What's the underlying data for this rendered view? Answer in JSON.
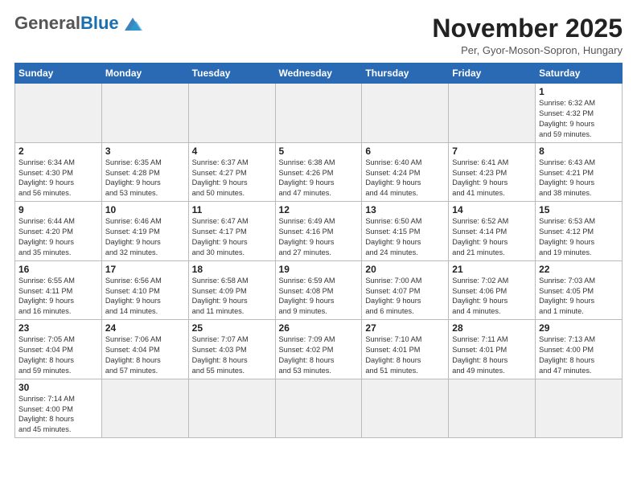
{
  "logo": {
    "general": "General",
    "blue": "Blue"
  },
  "header": {
    "month": "November 2025",
    "location": "Per, Gyor-Moson-Sopron, Hungary"
  },
  "weekdays": [
    "Sunday",
    "Monday",
    "Tuesday",
    "Wednesday",
    "Thursday",
    "Friday",
    "Saturday"
  ],
  "days": {
    "1": {
      "sunrise": "6:32 AM",
      "sunset": "4:32 PM",
      "daylight_h": "9",
      "daylight_m": "59"
    },
    "2": {
      "sunrise": "6:34 AM",
      "sunset": "4:30 PM",
      "daylight_h": "9",
      "daylight_m": "56"
    },
    "3": {
      "sunrise": "6:35 AM",
      "sunset": "4:28 PM",
      "daylight_h": "9",
      "daylight_m": "53"
    },
    "4": {
      "sunrise": "6:37 AM",
      "sunset": "4:27 PM",
      "daylight_h": "9",
      "daylight_m": "50"
    },
    "5": {
      "sunrise": "6:38 AM",
      "sunset": "4:26 PM",
      "daylight_h": "9",
      "daylight_m": "47"
    },
    "6": {
      "sunrise": "6:40 AM",
      "sunset": "4:24 PM",
      "daylight_h": "9",
      "daylight_m": "44"
    },
    "7": {
      "sunrise": "6:41 AM",
      "sunset": "4:23 PM",
      "daylight_h": "9",
      "daylight_m": "41"
    },
    "8": {
      "sunrise": "6:43 AM",
      "sunset": "4:21 PM",
      "daylight_h": "9",
      "daylight_m": "38"
    },
    "9": {
      "sunrise": "6:44 AM",
      "sunset": "4:20 PM",
      "daylight_h": "9",
      "daylight_m": "35"
    },
    "10": {
      "sunrise": "6:46 AM",
      "sunset": "4:19 PM",
      "daylight_h": "9",
      "daylight_m": "32"
    },
    "11": {
      "sunrise": "6:47 AM",
      "sunset": "4:17 PM",
      "daylight_h": "9",
      "daylight_m": "30"
    },
    "12": {
      "sunrise": "6:49 AM",
      "sunset": "4:16 PM",
      "daylight_h": "9",
      "daylight_m": "27"
    },
    "13": {
      "sunrise": "6:50 AM",
      "sunset": "4:15 PM",
      "daylight_h": "9",
      "daylight_m": "24"
    },
    "14": {
      "sunrise": "6:52 AM",
      "sunset": "4:14 PM",
      "daylight_h": "9",
      "daylight_m": "21"
    },
    "15": {
      "sunrise": "6:53 AM",
      "sunset": "4:12 PM",
      "daylight_h": "9",
      "daylight_m": "19"
    },
    "16": {
      "sunrise": "6:55 AM",
      "sunset": "4:11 PM",
      "daylight_h": "9",
      "daylight_m": "16"
    },
    "17": {
      "sunrise": "6:56 AM",
      "sunset": "4:10 PM",
      "daylight_h": "9",
      "daylight_m": "14"
    },
    "18": {
      "sunrise": "6:58 AM",
      "sunset": "4:09 PM",
      "daylight_h": "9",
      "daylight_m": "11"
    },
    "19": {
      "sunrise": "6:59 AM",
      "sunset": "4:08 PM",
      "daylight_h": "9",
      "daylight_m": "9"
    },
    "20": {
      "sunrise": "7:00 AM",
      "sunset": "4:07 PM",
      "daylight_h": "9",
      "daylight_m": "6"
    },
    "21": {
      "sunrise": "7:02 AM",
      "sunset": "4:06 PM",
      "daylight_h": "9",
      "daylight_m": "4"
    },
    "22": {
      "sunrise": "7:03 AM",
      "sunset": "4:05 PM",
      "daylight_h": "9",
      "daylight_m": "1"
    },
    "23": {
      "sunrise": "7:05 AM",
      "sunset": "4:04 PM",
      "daylight_h": "8",
      "daylight_m": "59"
    },
    "24": {
      "sunrise": "7:06 AM",
      "sunset": "4:04 PM",
      "daylight_h": "8",
      "daylight_m": "57"
    },
    "25": {
      "sunrise": "7:07 AM",
      "sunset": "4:03 PM",
      "daylight_h": "8",
      "daylight_m": "55"
    },
    "26": {
      "sunrise": "7:09 AM",
      "sunset": "4:02 PM",
      "daylight_h": "8",
      "daylight_m": "53"
    },
    "27": {
      "sunrise": "7:10 AM",
      "sunset": "4:01 PM",
      "daylight_h": "8",
      "daylight_m": "51"
    },
    "28": {
      "sunrise": "7:11 AM",
      "sunset": "4:01 PM",
      "daylight_h": "8",
      "daylight_m": "49"
    },
    "29": {
      "sunrise": "7:13 AM",
      "sunset": "4:00 PM",
      "daylight_h": "8",
      "daylight_m": "47"
    },
    "30": {
      "sunrise": "7:14 AM",
      "sunset": "4:00 PM",
      "daylight_h": "8",
      "daylight_m": "45"
    }
  }
}
